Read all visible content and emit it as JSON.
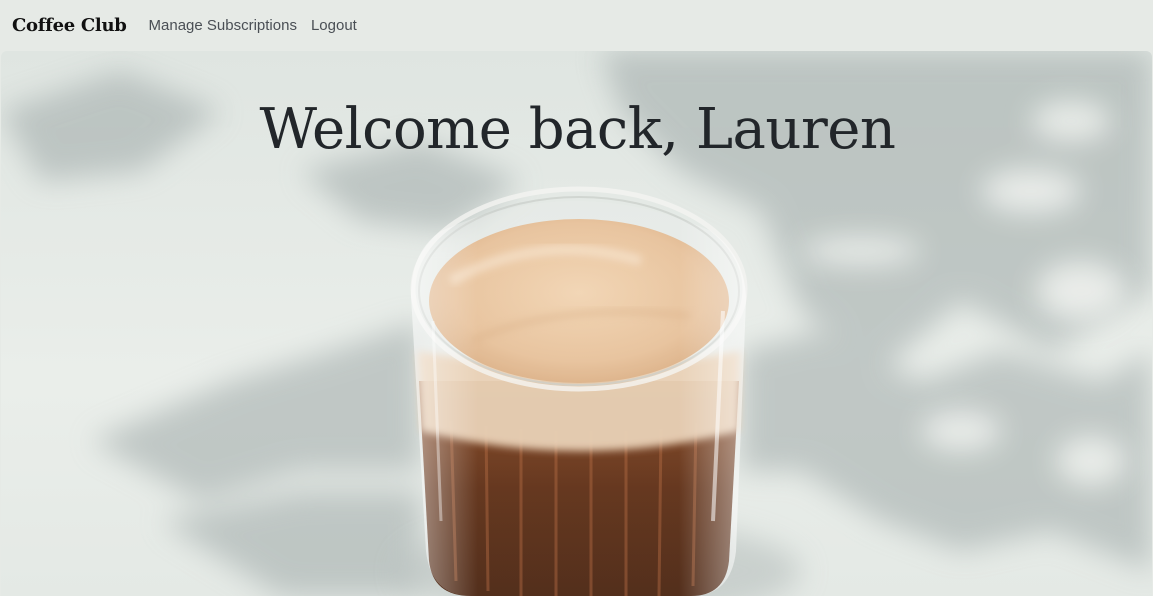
{
  "nav": {
    "brand": "Coffee Club",
    "links": [
      "Manage Subscriptions",
      "Logout"
    ]
  },
  "hero": {
    "headline": "Welcome back, Lauren"
  },
  "colors": {
    "background": "#e6eae6",
    "headline": "#22262a",
    "link": "#4a4f55"
  }
}
